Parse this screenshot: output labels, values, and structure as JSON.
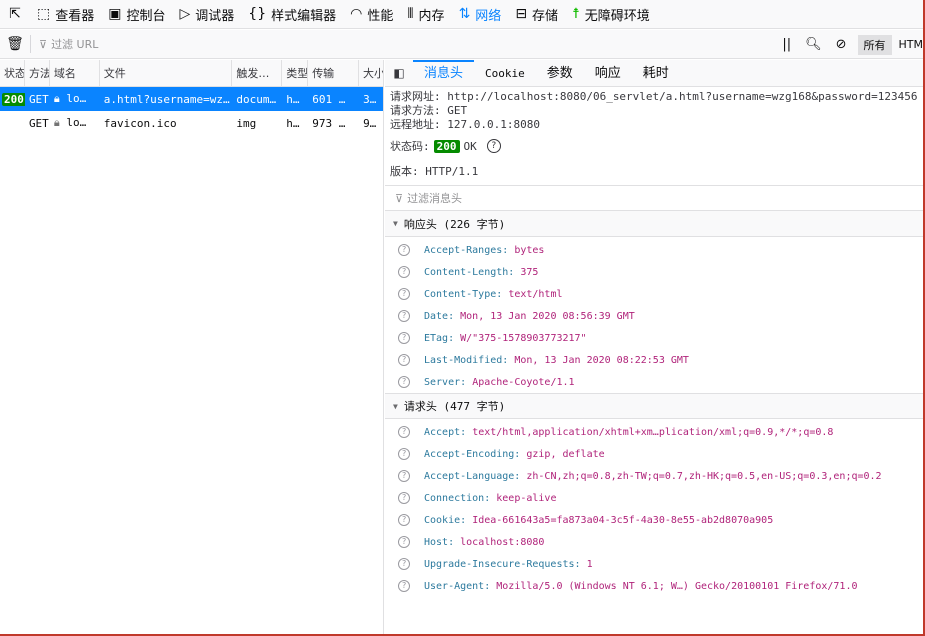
{
  "toolbar": {
    "tabs": [
      {
        "label": "查看器",
        "icon": "inspector-icon",
        "glyph": "⬚"
      },
      {
        "label": "控制台",
        "icon": "console-icon",
        "glyph": "▣"
      },
      {
        "label": "调试器",
        "icon": "debugger-icon",
        "glyph": "▷"
      },
      {
        "label": "样式编辑器",
        "icon": "style-editor-icon",
        "glyph": "{}"
      },
      {
        "label": "性能",
        "icon": "performance-icon",
        "glyph": "◠"
      },
      {
        "label": "内存",
        "icon": "memory-icon",
        "glyph": "⦀"
      },
      {
        "label": "网络",
        "icon": "network-icon",
        "glyph": "⇅"
      },
      {
        "label": "存储",
        "icon": "storage-icon",
        "glyph": "⊟"
      },
      {
        "label": "无障碍环境",
        "icon": "accessibility-icon",
        "glyph": "☨"
      }
    ],
    "selected": "网络"
  },
  "filter_bar": {
    "placeholder": "过滤 URL",
    "pause_glyph": "||",
    "all_label": "所有",
    "html_label": "HTM"
  },
  "request_list": {
    "columns": [
      "状态",
      "方法",
      "域名",
      "文件",
      "触发…",
      "类型",
      "传输",
      "大小"
    ],
    "rows": [
      {
        "status": "200",
        "method": "GET",
        "domain": "lo…",
        "file": "a.html?username=wz…",
        "trigger": "docum…",
        "type": "h…",
        "transferred": "601 …",
        "size": "3…"
      },
      {
        "status": "",
        "method": "GET",
        "domain": "lo…",
        "file": "favicon.ico",
        "trigger": "img",
        "type": "h…",
        "transferred": "973 …",
        "size": "9…"
      }
    ]
  },
  "details": {
    "tabs": [
      "消息头",
      "Cookie",
      "参数",
      "响应",
      "耗时"
    ],
    "active_tab": "消息头",
    "request_url_label": "请求网址:",
    "request_url": "http://localhost:8080/06_servlet/a.html?username=wzg168&password=123456",
    "request_method_label": "请求方法:",
    "request_method": "GET",
    "remote_address_label": "远程地址:",
    "remote_address": "127.0.0.1:8080",
    "status_label": "状态码:",
    "status_code": "200",
    "status_text": "OK",
    "version_label": "版本:",
    "version": "HTTP/1.1",
    "header_filter_placeholder": "过滤消息头",
    "response_headers": {
      "title": "响应头 (226 字节)",
      "items": [
        {
          "name": "Accept-Ranges:",
          "value": "bytes"
        },
        {
          "name": "Content-Length:",
          "value": "375"
        },
        {
          "name": "Content-Type:",
          "value": "text/html"
        },
        {
          "name": "Date:",
          "value": "Mon, 13 Jan 2020 08:56:39 GMT"
        },
        {
          "name": "ETag:",
          "value": "W/\"375-1578903773217\""
        },
        {
          "name": "Last-Modified:",
          "value": "Mon, 13 Jan 2020 08:22:53 GMT"
        },
        {
          "name": "Server:",
          "value": "Apache-Coyote/1.1"
        }
      ]
    },
    "request_headers": {
      "title": "请求头 (477 字节)",
      "items": [
        {
          "name": "Accept:",
          "value": "text/html,application/xhtml+xm…plication/xml;q=0.9,*/*;q=0.8"
        },
        {
          "name": "Accept-Encoding:",
          "value": "gzip, deflate"
        },
        {
          "name": "Accept-Language:",
          "value": "zh-CN,zh;q=0.8,zh-TW;q=0.7,zh-HK;q=0.5,en-US;q=0.3,en;q=0.2"
        },
        {
          "name": "Connection:",
          "value": "keep-alive"
        },
        {
          "name": "Cookie:",
          "value": "Idea-661643a5=fa873a04-3c5f-4a30-8e55-ab2d8070a905"
        },
        {
          "name": "Host:",
          "value": "localhost:8080"
        },
        {
          "name": "Upgrade-Insecure-Requests:",
          "value": "1"
        },
        {
          "name": "User-Agent:",
          "value": "Mozilla/5.0 (Windows NT 6.1; W…) Gecko/20100101 Firefox/71.0"
        }
      ]
    }
  },
  "colors": {
    "accent": "#0a84ff",
    "status_ok": "#058b00",
    "header_name": "#2d7a9e",
    "header_value": "#b0237a"
  }
}
